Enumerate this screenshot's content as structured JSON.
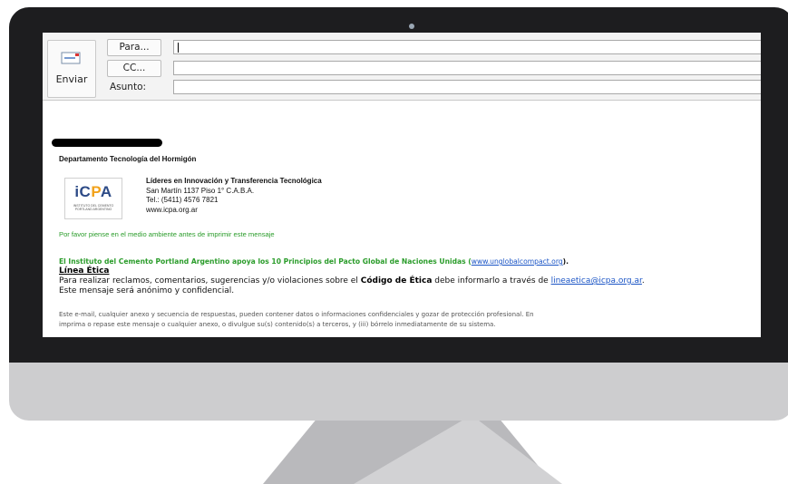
{
  "compose": {
    "send_label": "Enviar",
    "to_label": "Para...",
    "cc_label": "CC...",
    "subject_label": "Asunto:",
    "to_value": "",
    "cc_value": "",
    "subject_value": ""
  },
  "signature": {
    "department": "Departamento Tecnología del Hormigón",
    "logo_text_a": "iC",
    "logo_text_b": "P",
    "logo_text_c": "A",
    "logo_sub_1": "INSTITUTO DEL CEMENTO",
    "logo_sub_2": "PORTLAND ARGENTINO",
    "tagline": "Líderes en Innovación y Transferencia Tecnológica",
    "address": "San Martín 1137 Piso 1° C.A.B.A.",
    "phone": "Tel.: (5411) 4576 7821",
    "website": "www.icpa.org.ar",
    "environment_note": "Por favor piense en el medio ambiente antes de imprimir este mensaje"
  },
  "footer": {
    "global_compact_text": "El Instituto del Cemento Portland Argentino apoya los 10 Principios del Pacto Global de Naciones Unidas (",
    "global_compact_link": "www.unglobalcompact.org",
    "global_compact_tail": ").",
    "ethics_title": "Línea Ética",
    "ethics_line1_a": "Para realizar reclamos, comentarios, sugerencias y/o violaciones sobre el ",
    "ethics_code": "Código de Ética",
    "ethics_line1_b": " debe informarlo a través de ",
    "ethics_email": "lineaetica@icpa.org.ar",
    "ethics_line1_c": ".",
    "ethics_line2": "Este mensaje será anónimo y confidencial.",
    "disclaimer_line1": "Este e-mail, cualquier anexo y secuencia de respuestas, pueden contener datos o informaciones confidenciales y gozar de protección profesional. En",
    "disclaimer_line2": "imprima o repase este mensaje o cualquier anexo, o divulgue su(s) contenido(s) a terceros, y (iii) bórrelo inmediatamente de su sistema."
  },
  "colors": {
    "green_text": "#2a9c2a",
    "link_blue": "#1a54c5",
    "logo_blue": "#2c4a86",
    "logo_orange": "#f2a21a",
    "monitor_bezel": "#1d1d1f"
  }
}
